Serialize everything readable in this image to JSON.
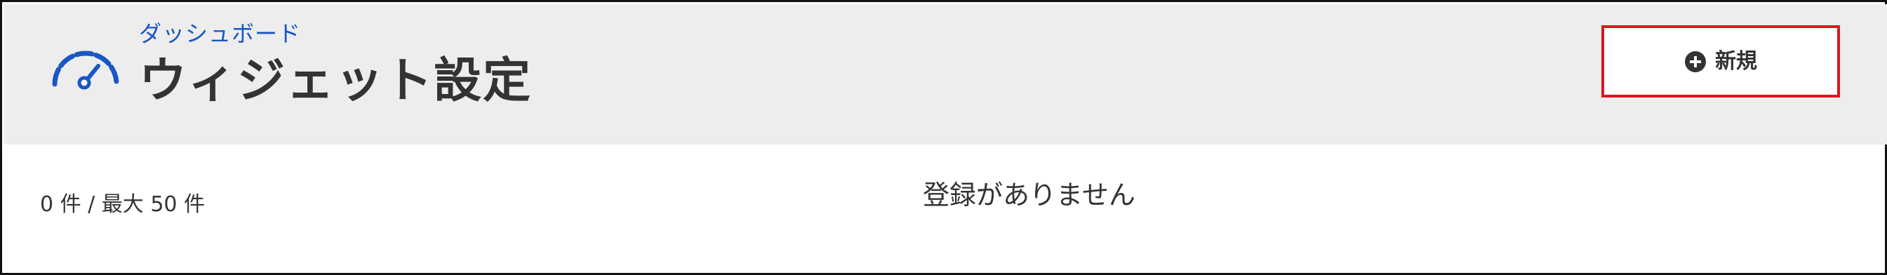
{
  "header": {
    "breadcrumb": "ダッシュボード",
    "title": "ウィジェット設定",
    "icon": "dashboard-gauge-icon"
  },
  "toolbar": {
    "new_label": "新規",
    "new_icon": "plus-circle-icon"
  },
  "list": {
    "count_text": "0 件 / 最大 50 件",
    "empty_message": "登録がありません"
  },
  "colors": {
    "header_bg": "#ededed",
    "link": "#1a56c4",
    "icon_blue": "#1a56c4",
    "button_border": "#e0141e",
    "text": "#333333"
  }
}
